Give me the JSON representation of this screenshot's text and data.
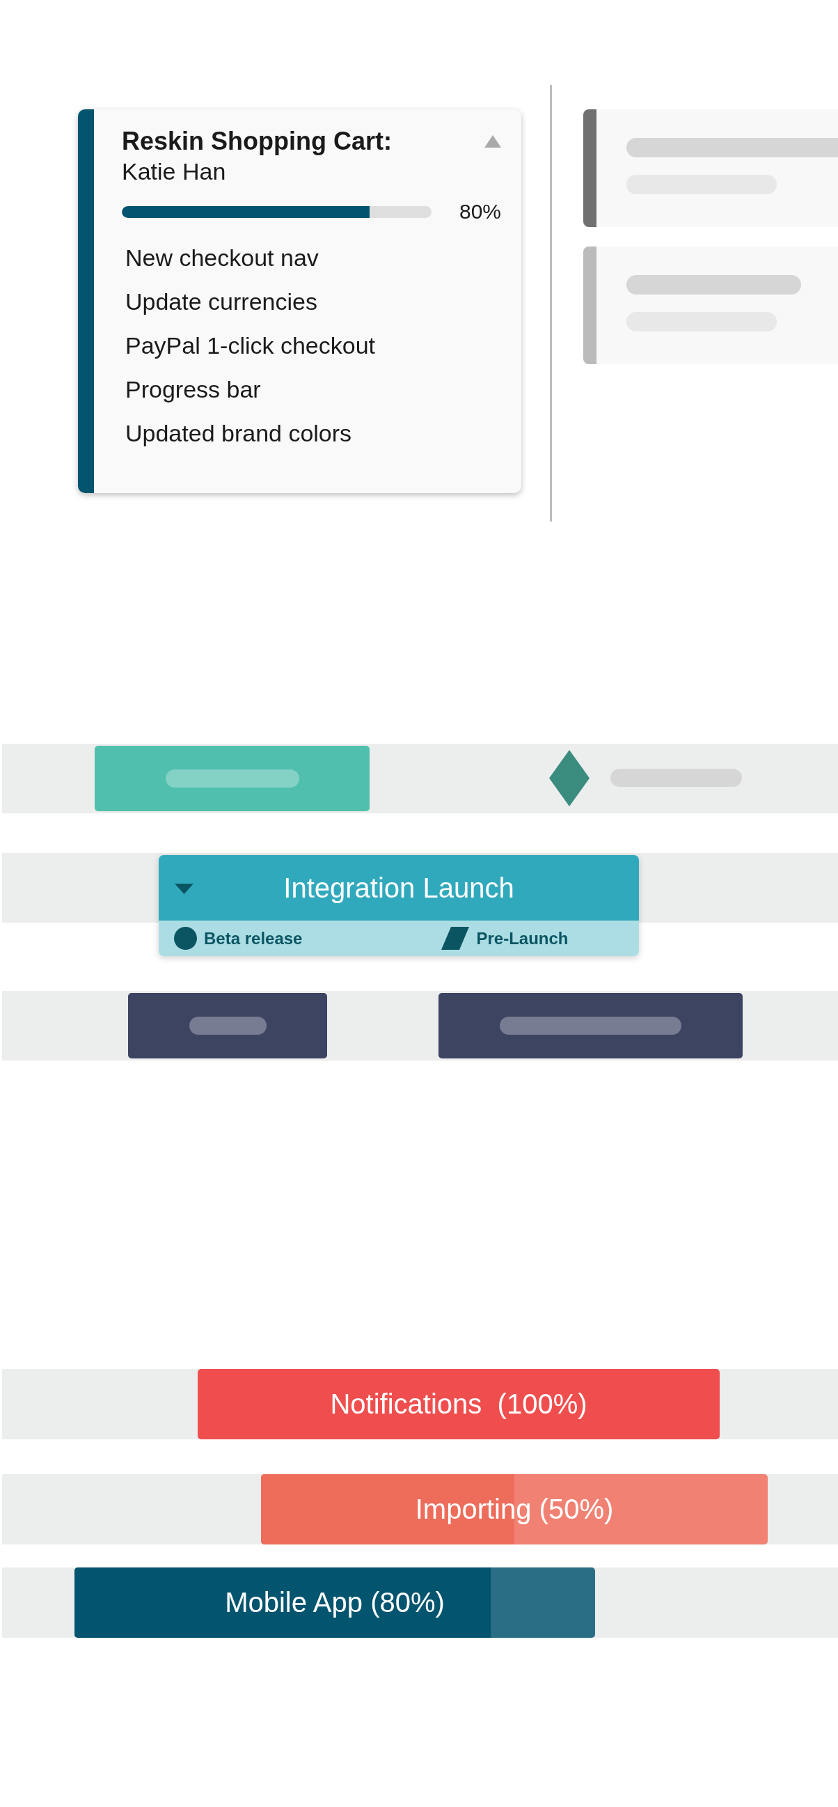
{
  "project_card": {
    "title": "Reskin Shopping Cart:",
    "owner": "Katie Han",
    "progress": {
      "level": 0.8,
      "reading": "80%"
    },
    "tasks": [
      "New checkout nav",
      "Update currencies",
      "PayPal 1-click checkout",
      "Progress bar",
      "Updated brand colors"
    ]
  },
  "integration": {
    "title": "Integration Launch",
    "milestones": [
      {
        "label": "Beta release",
        "kind": "circle"
      },
      {
        "label": "Pre-Launch",
        "kind": "parallelogram"
      }
    ]
  },
  "progress_bars": [
    {
      "label": "Notifications  (100%)",
      "level": 1,
      "color": "#f04e4e"
    },
    {
      "label": "Importing (50%)",
      "level": 0.5,
      "color": "#ee6c5a"
    },
    {
      "label": "Mobile App (80%)",
      "level": 0.8,
      "color": "#03546e"
    }
  ]
}
